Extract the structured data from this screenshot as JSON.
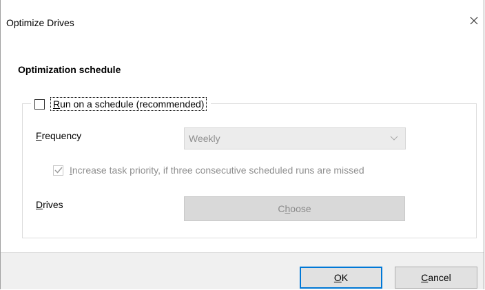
{
  "window": {
    "title": "Optimize Drives",
    "close_icon": "close-icon"
  },
  "schedule": {
    "section_title": "Optimization schedule",
    "run_on_schedule": {
      "label": "Run on a schedule (recommended)",
      "mnemonic": "R",
      "rest": "un on a schedule (recommended)",
      "checked": false
    },
    "frequency": {
      "label": "Frequency",
      "mnemonic": "F",
      "rest": "requency",
      "value": "Weekly",
      "enabled": false
    },
    "increase_priority": {
      "label": "Increase task priority, if three consecutive scheduled runs are missed",
      "prefix": "",
      "mnemonic": "I",
      "rest": "ncrease task priority, if three consecutive scheduled runs are missed",
      "checked": true,
      "enabled": false
    },
    "drives": {
      "label": "Drives",
      "mnemonic": "D",
      "rest": "rives",
      "button_label": "Choose",
      "button_prefix": "C",
      "button_mnemonic": "h",
      "button_rest": "oose",
      "enabled": false
    }
  },
  "footer": {
    "ok_label": "OK",
    "ok_mnemonic": "O",
    "ok_rest": "K",
    "cancel_label": "Cancel",
    "cancel_mnemonic": "C",
    "cancel_rest": "ancel"
  },
  "colors": {
    "accent": "#0078d7",
    "disabled_text": "#8e8e8e",
    "footer_background": "#f0f0f0"
  }
}
